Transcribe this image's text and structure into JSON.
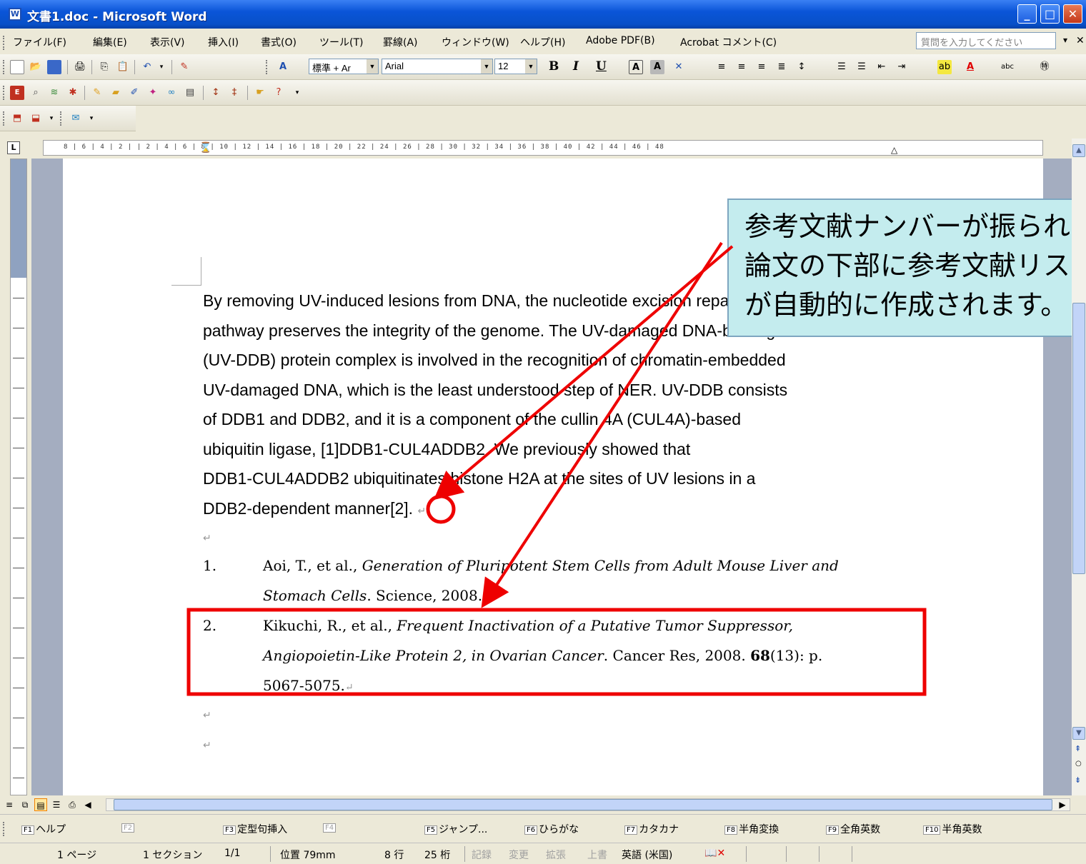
{
  "window": {
    "title": "文書1.doc - Microsoft Word"
  },
  "menu": {
    "items": [
      "ファイル(F)",
      "編集(E)",
      "表示(V)",
      "挿入(I)",
      "書式(O)",
      "ツール(T)",
      "罫線(A)",
      "ウィンドウ(W)",
      "ヘルプ(H)",
      "Adobe PDF(B)",
      "Acrobat コメント(C)"
    ],
    "help_placeholder": "質問を入力してください"
  },
  "formatting": {
    "style": "標準 + Ar",
    "font": "Arial",
    "size": "12",
    "bold": "B",
    "italic": "I",
    "underline": "U"
  },
  "ruler": {
    "labels": "8 | 6 | 4 | 2 |    | 2 | 4 | 6 | 8 | 10 | 12 | 14 | 16 | 18 | 20 | 22 | 24 | 26 | 28 | 30 | 32 | 34 | 36 | 38 | 40 | 42 | 44 | 46 | 48"
  },
  "document": {
    "paragraph_lines": [
      "By removing UV-induced lesions from DNA, the nucleotide excision repair (NER)",
      "pathway preserves the integrity of the genome. The UV-damaged DNA-binding",
      "(UV-DDB) protein complex is involved in the recognition of chromatin-embedded",
      "UV-damaged DNA, which is the least understood step of NER. UV-DDB consists",
      "of DDB1 and DDB2, and it is a component of the cullin 4A (CUL4A)-based",
      "ubiquitin ligase, [1]DDB1-CUL4ADDB2. We previously showed that",
      "DDB1-CUL4ADDB2 ubiquitinates histone H2A at the sites of UV lesions in a"
    ],
    "last_line_text": "DDB2-dependent manner",
    "citation": "[2].",
    "references": [
      {
        "number": "1.",
        "line1_authors": "Aoi, T., et al., ",
        "line1_title": "Generation of Pluripotent Stem Cells from Adult Mouse Liver and",
        "line2_title": "Stomach Cells",
        "line2_rest": ". Science, 2008."
      },
      {
        "number": "2.",
        "line1_authors": "Kikuchi, R., et al., ",
        "line1_title": "Frequent Inactivation of a Putative Tumor Suppressor,",
        "line2_title": "Angiopoietin-Like Protein 2, in Ovarian Cancer",
        "line2_rest": ". Cancer Res, 2008. ",
        "volume": "68",
        "issue_pages": "(13): p.",
        "line3": "5067-5075."
      }
    ]
  },
  "callout": {
    "lines": [
      "参考文献ナンバーが振られ、",
      "論文の下部に参考文献リスト",
      "が自動的に作成されます。"
    ]
  },
  "fkeys": [
    {
      "key": "F1",
      "label": "ヘルプ"
    },
    {
      "key": "F2",
      "label": ""
    },
    {
      "key": "F3",
      "label": "定型句挿入"
    },
    {
      "key": "F4",
      "label": ""
    },
    {
      "key": "F5",
      "label": "ジャンプ..."
    },
    {
      "key": "F6",
      "label": "ひらがな"
    },
    {
      "key": "F7",
      "label": "カタカナ"
    },
    {
      "key": "F8",
      "label": "半角変換"
    },
    {
      "key": "F9",
      "label": "全角英数"
    },
    {
      "key": "F10",
      "label": "半角英数"
    }
  ],
  "status": {
    "page": "1 ページ",
    "section": "1 セクション",
    "page_of": "1/1",
    "position": "位置 79mm",
    "line": "8 行",
    "column": "25 桁",
    "rec": "記録",
    "trk": "変更",
    "ext": "拡張",
    "ovr": "上書",
    "language": "英語 (米国)"
  },
  "colors": {
    "highlight_red": "#ee0000",
    "callout_bg": "#c4ecee",
    "title_blue": "#0a55d8"
  }
}
